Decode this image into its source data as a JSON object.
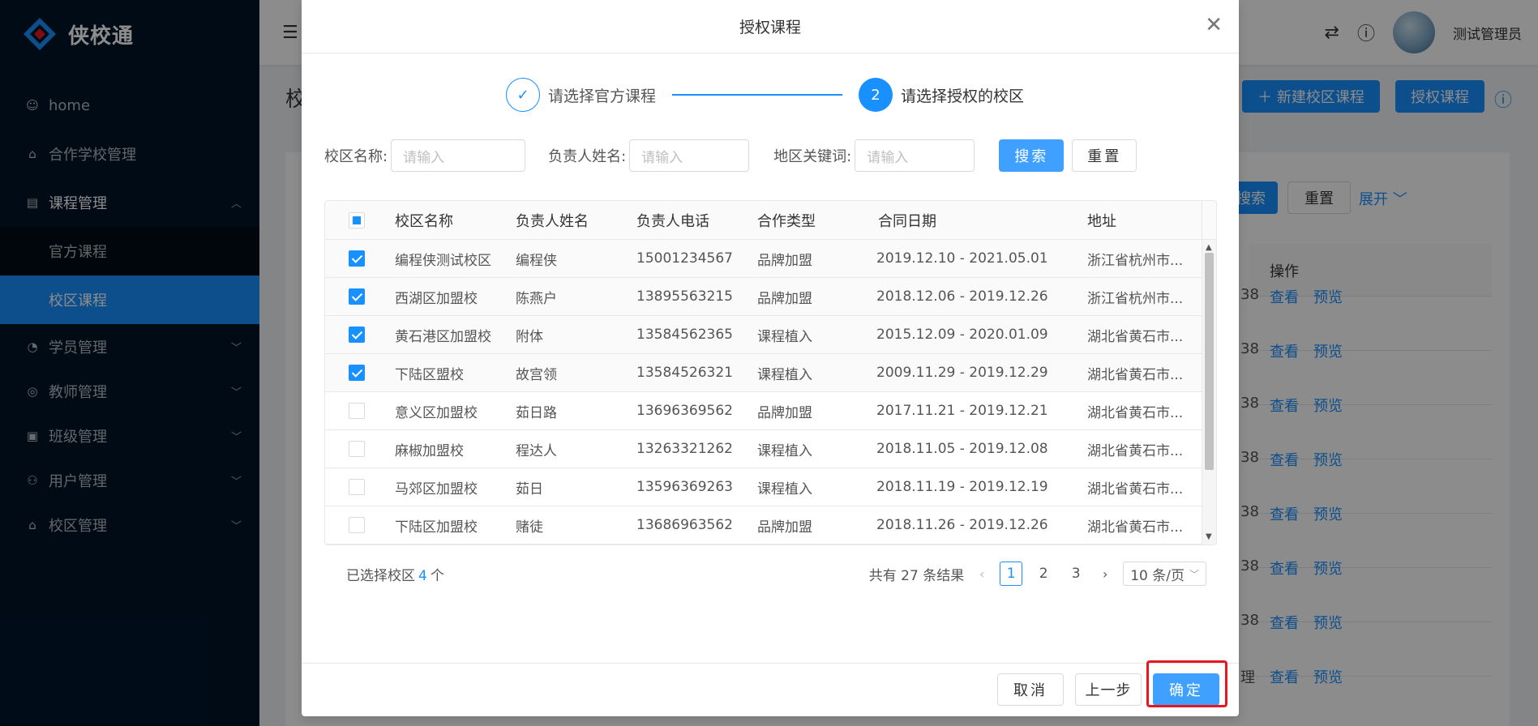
{
  "app": {
    "name": "侠校通"
  },
  "sidebar": {
    "items": [
      {
        "label": "home",
        "icon": "smile-icon"
      },
      {
        "label": "合作学校管理",
        "icon": "building-icon"
      },
      {
        "label": "课程管理",
        "icon": "book-icon",
        "open": true,
        "children": [
          {
            "label": "官方课程"
          },
          {
            "label": "校区课程",
            "active": true
          }
        ]
      },
      {
        "label": "学员管理",
        "icon": "student-icon"
      },
      {
        "label": "教师管理",
        "icon": "teacher-icon"
      },
      {
        "label": "班级管理",
        "icon": "class-icon"
      },
      {
        "label": "用户管理",
        "icon": "users-icon"
      },
      {
        "label": "校区管理",
        "icon": "campus-icon"
      }
    ]
  },
  "header": {
    "username": "测试管理员"
  },
  "background": {
    "page_title": "校",
    "new_button": "＋ 新建校区课程",
    "auth_button": "授权课程",
    "search_button": "搜索",
    "reset_button": "重置",
    "expand_link": "展开",
    "ops_header": "操作",
    "view_link": "查看",
    "preview_link": "预览",
    "row_fragment": "38",
    "row_fragment_last": "理"
  },
  "modal": {
    "title": "授权课程",
    "steps": [
      {
        "index": "1",
        "title": "请选择官方课程",
        "status": "done"
      },
      {
        "index": "2",
        "title": "请选择授权的校区",
        "status": "current"
      }
    ],
    "filters": {
      "name_label": "校区名称:",
      "name_placeholder": "请输入",
      "owner_label": "负责人姓名:",
      "owner_placeholder": "请输入",
      "region_label": "地区关键词:",
      "region_placeholder": "请输入",
      "search_button": "搜索",
      "reset_button": "重置"
    },
    "table": {
      "columns": [
        "校区名称",
        "负责人姓名",
        "负责人电话",
        "合作类型",
        "合同日期",
        "地址"
      ],
      "rows": [
        {
          "checked": true,
          "name": "编程侠测试校区",
          "owner": "编程侠",
          "phone": "15001234567",
          "type": "品牌加盟",
          "date": "2019.12.10 - 2021.05.01",
          "address": "浙江省杭州市..."
        },
        {
          "checked": true,
          "name": "西湖区加盟校",
          "owner": "陈燕户",
          "phone": "13895563215",
          "type": "品牌加盟",
          "date": "2018.12.06 - 2019.12.26",
          "address": "浙江省杭州市..."
        },
        {
          "checked": true,
          "name": "黄石港区加盟校",
          "owner": "附体",
          "phone": "13584562365",
          "type": "课程植入",
          "date": "2015.12.09 - 2020.01.09",
          "address": "湖北省黄石市..."
        },
        {
          "checked": true,
          "name": "下陆区盟校",
          "owner": "故宫领",
          "phone": "13584526321",
          "type": "课程植入",
          "date": "2009.11.29 - 2019.12.29",
          "address": "湖北省黄石市..."
        },
        {
          "checked": false,
          "name": "意义区加盟校",
          "owner": "茹日路",
          "phone": "13696369562",
          "type": "品牌加盟",
          "date": "2017.11.21 - 2019.12.21",
          "address": "湖北省黄石市..."
        },
        {
          "checked": false,
          "name": "麻椒加盟校",
          "owner": "程达人",
          "phone": "13263321262",
          "type": "课程植入",
          "date": "2018.11.05 - 2019.12.08",
          "address": "湖北省黄石市..."
        },
        {
          "checked": false,
          "name": "马郊区加盟校",
          "owner": "茹日",
          "phone": "13596369263",
          "type": "课程植入",
          "date": "2018.11.19 - 2019.12.19",
          "address": "湖北省黄石市..."
        },
        {
          "checked": false,
          "name": "下陆区加盟校",
          "owner": "赌徒",
          "phone": "13686963562",
          "type": "品牌加盟",
          "date": "2018.11.26 - 2019.12.26",
          "address": "湖北省黄石市..."
        }
      ]
    },
    "selection": {
      "prefix": "已选择校区",
      "count": "4",
      "suffix": "个"
    },
    "pagination": {
      "total_text": "共有 27 条结果",
      "pages": [
        "1",
        "2",
        "3"
      ],
      "current": "1",
      "page_size": "10 条/页"
    },
    "footer": {
      "cancel": "取消",
      "prev": "上一步",
      "confirm": "确定"
    }
  },
  "colors": {
    "primary": "#1890ff",
    "sidebar": "#001529",
    "highlight": "#e8161e"
  }
}
